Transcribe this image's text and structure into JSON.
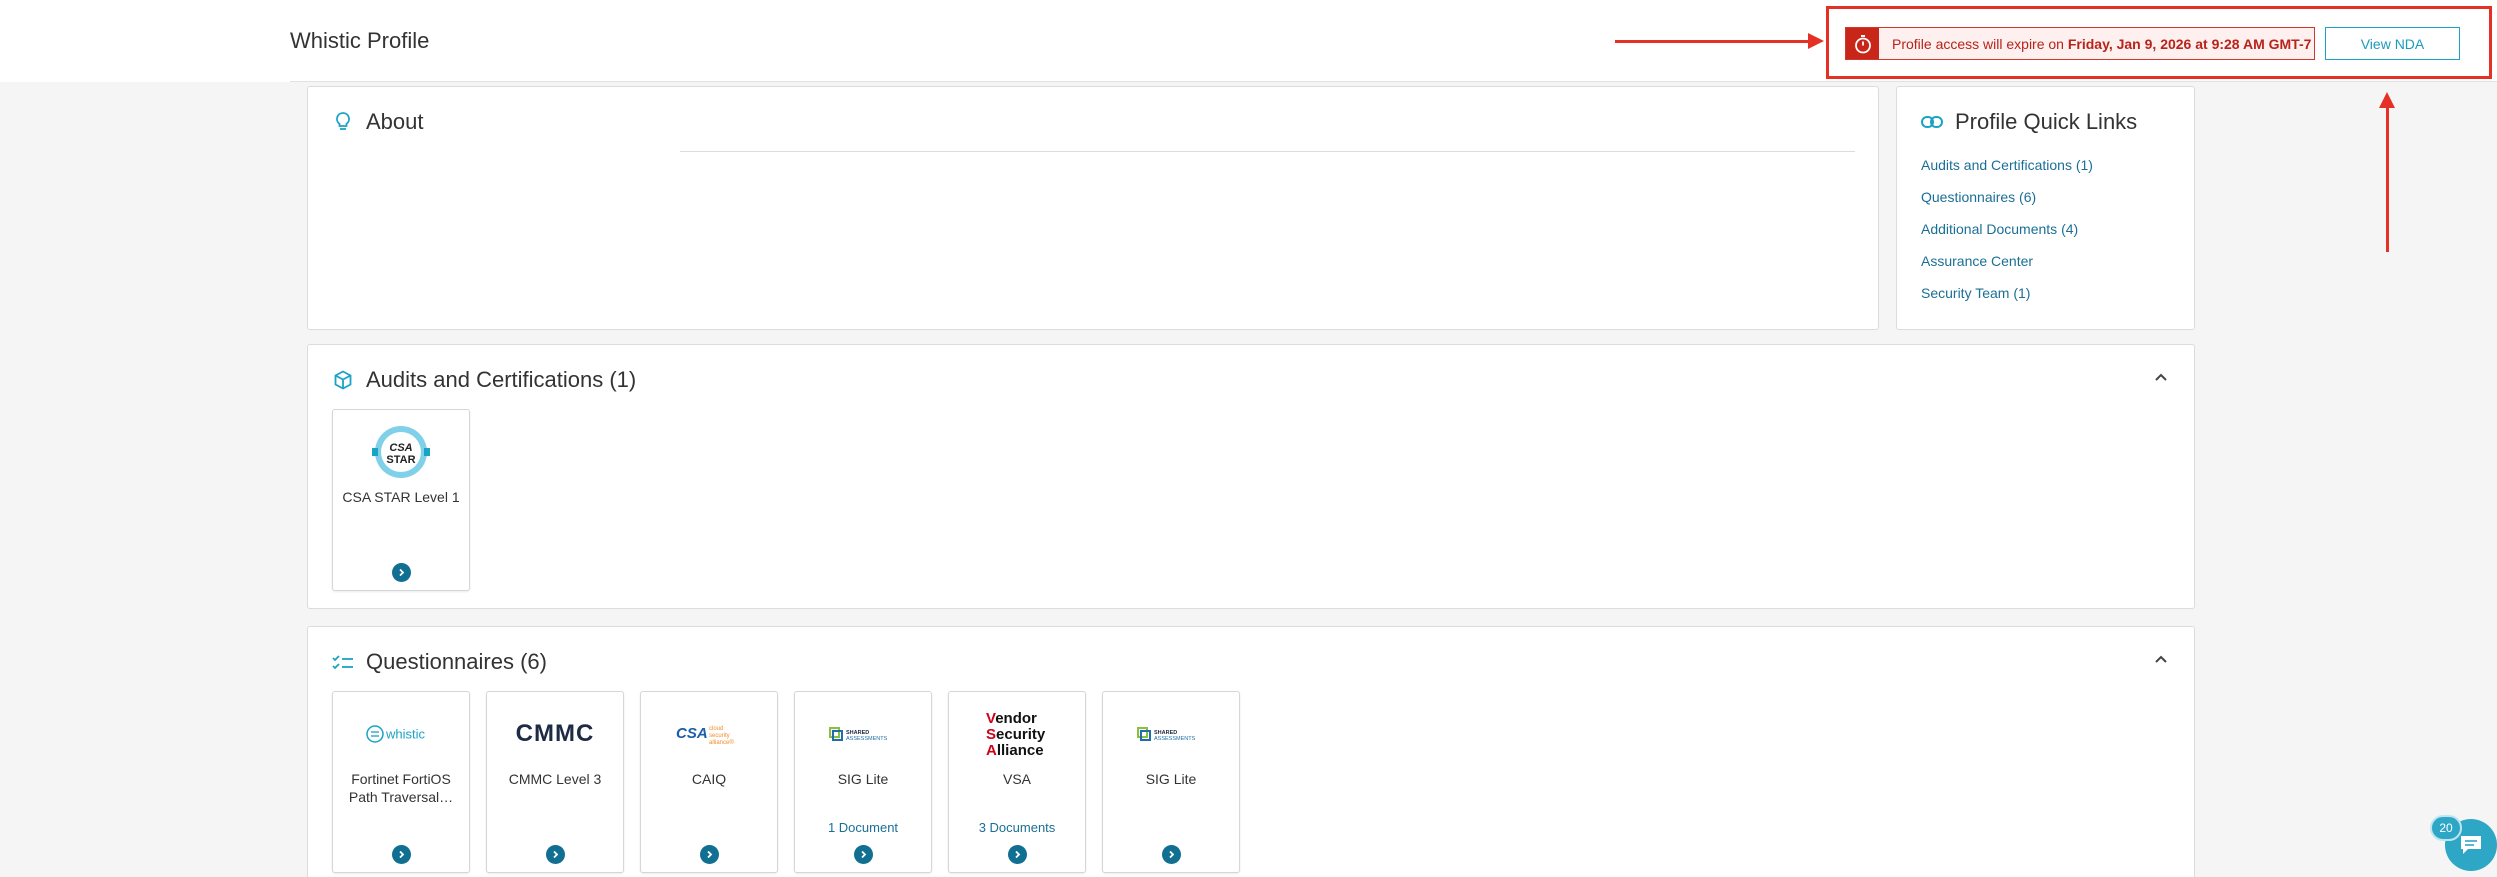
{
  "header": {
    "title": "Whistic Profile",
    "expire_prefix": "Profile access will expire on ",
    "expire_date": "Friday, Jan 9, 2026 at 9:28 AM GMT-7",
    "view_nda_label": "View NDA"
  },
  "about": {
    "title": "About"
  },
  "quick_links": {
    "title": "Profile Quick Links",
    "items": [
      {
        "label": "Audits and Certifications  (1)"
      },
      {
        "label": "Questionnaires  (6)"
      },
      {
        "label": "Additional Documents  (4)"
      },
      {
        "label": "Assurance Center"
      },
      {
        "label": "Security Team  (1)"
      }
    ]
  },
  "audits": {
    "title": "Audits and Certifications (1)",
    "tiles": [
      {
        "name": "CSA STAR Level 1",
        "logo_text": "CSA STAR"
      }
    ]
  },
  "questionnaires": {
    "title": "Questionnaires (6)",
    "tiles": [
      {
        "name": "Fortinet FortiOS Path Traversal…",
        "logo_text": "whistic",
        "docs": ""
      },
      {
        "name": "CMMC Level 3",
        "logo_text": "CMMC",
        "docs": ""
      },
      {
        "name": "CAIQ",
        "logo_text": "CSA",
        "logo_sub": "cloud security alliance",
        "docs": ""
      },
      {
        "name": "SIG Lite",
        "logo_text": "SHARED ASSESSMENTS",
        "docs": "1 Document"
      },
      {
        "name": "VSA",
        "logo_lines": [
          "Vendor",
          "Security",
          "Alliance"
        ],
        "docs": "3 Documents"
      },
      {
        "name": "SIG Lite",
        "logo_text": "SHARED ASSESSMENTS",
        "docs": ""
      }
    ]
  },
  "chat": {
    "badge_count": "20"
  },
  "colors": {
    "accent": "#1a9bbd",
    "link": "#1b6f96",
    "alert": "#c9261a",
    "annotation": "#e53125"
  }
}
